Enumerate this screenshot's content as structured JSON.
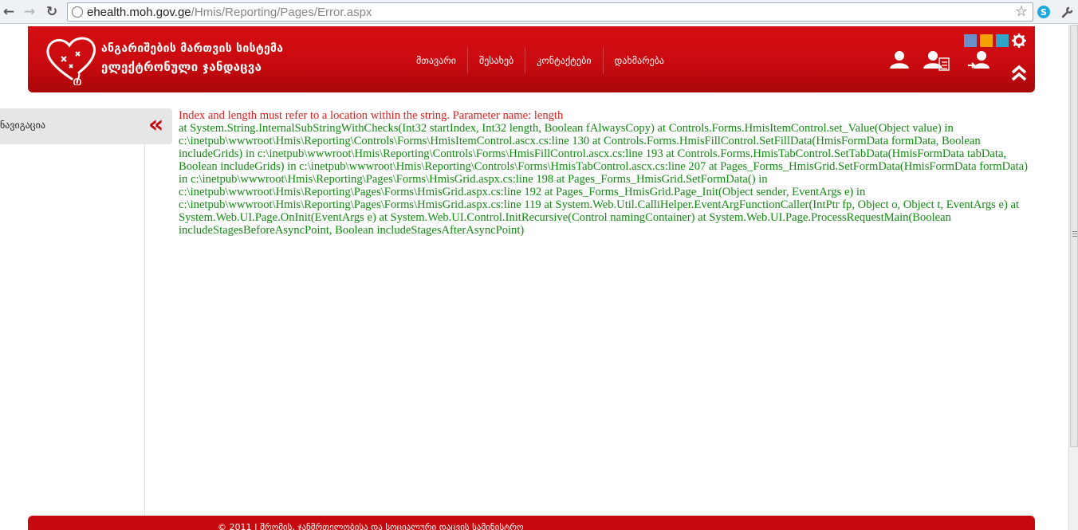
{
  "browser": {
    "url_host": "ehealth.moh.gov.ge",
    "url_path": "/Hmis/Reporting/Pages/Error.aspx"
  },
  "header": {
    "title_line1": "ანგარიშების მართვის სისტემა",
    "title_line2": "ელექტრონული ჯანდაცვა",
    "menu": [
      {
        "label": "მთავარი"
      },
      {
        "label": "შესახებ"
      },
      {
        "label": "კონტაქტები"
      },
      {
        "label": "დახმარება"
      }
    ],
    "tile_colors": [
      "#6b8fc9",
      "#f3a200",
      "#2fa4c6"
    ]
  },
  "sidebar": {
    "nav_label": "ნავიგაცია",
    "collapse_glyph": "«"
  },
  "error": {
    "message": "Index and length must refer to a location within the string. Parameter name: length",
    "stack_trace": "at System.String.InternalSubStringWithChecks(Int32 startIndex, Int32 length, Boolean fAlwaysCopy) at Controls.Forms.HmisItemControl.set_Value(Object value) in c:\\inetpub\\wwwroot\\Hmis\\Reporting\\Controls\\Forms\\HmisItemControl.ascx.cs:line 130 at Controls.Forms.HmisFillControl.SetFillData(HmisFormData formData, Boolean includeGrids) in c:\\inetpub\\wwwroot\\Hmis\\Reporting\\Controls\\Forms\\HmisFillControl.ascx.cs:line 193 at Controls.Forms.HmisTabControl.SetTabData(HmisFormData tabData, Boolean includeGrids) in c:\\inetpub\\wwwroot\\Hmis\\Reporting\\Controls\\Forms\\HmisTabControl.ascx.cs:line 207 at Pages_Forms_HmisGrid.SetFormData(HmisFormData formData) in c:\\inetpub\\wwwroot\\Hmis\\Reporting\\Pages\\Forms\\HmisGrid.aspx.cs:line 198 at Pages_Forms_HmisGrid.SetFormData() in c:\\inetpub\\wwwroot\\Hmis\\Reporting\\Pages\\Forms\\HmisGrid.aspx.cs:line 192 at Pages_Forms_HmisGrid.Page_Init(Object sender, EventArgs e) in c:\\inetpub\\wwwroot\\Hmis\\Reporting\\Pages\\Forms\\HmisGrid.aspx.cs:line 119 at System.Web.Util.CalliHelper.EventArgFunctionCaller(IntPtr fp, Object o, Object t, EventArgs e) at System.Web.UI.Page.OnInit(EventArgs e) at System.Web.UI.Control.InitRecursive(Control namingContainer) at System.Web.UI.Page.ProcessRequestMain(Boolean includeStagesBeforeAsyncPoint, Boolean includeStagesAfterAsyncPoint)"
  },
  "footer": {
    "text": "© 2011 | შრომის, ჯანმრთელობისა და სოციალური დაცვის სამინისტრო"
  }
}
